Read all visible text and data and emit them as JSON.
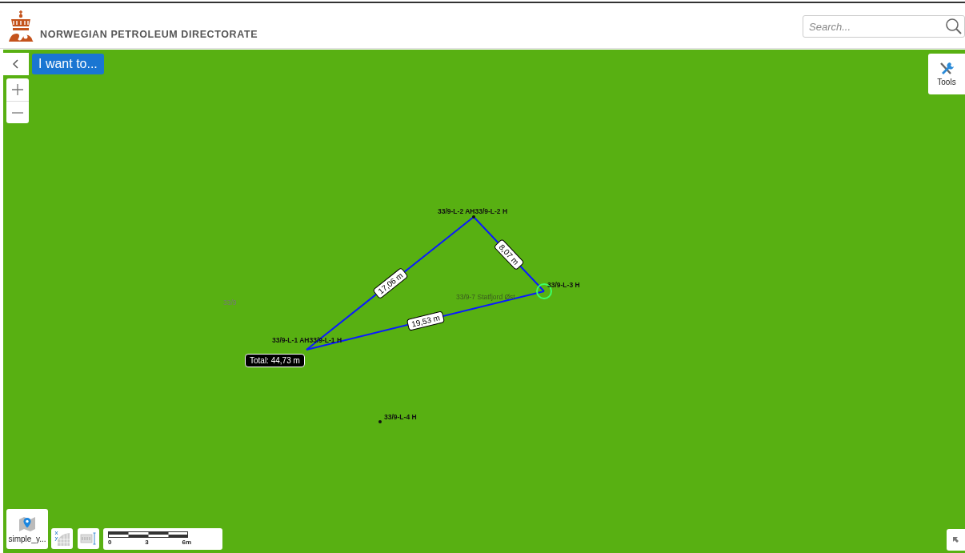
{
  "header": {
    "title": "NORWEGIAN PETROLEUM DIRECTORATE",
    "search": {
      "placeholder": "Search..."
    }
  },
  "controls": {
    "menu_button": "I want to...",
    "tools": "Tools"
  },
  "map": {
    "labels": [
      {
        "kind": "well",
        "text": "33/9-L-2 AH33/9-L-2 H"
      },
      {
        "kind": "well",
        "text": "33/9-L-3 H"
      },
      {
        "kind": "block",
        "text": "33/9"
      },
      {
        "kind": "field",
        "text": "33/9-7 Statfjord Øst"
      },
      {
        "kind": "well",
        "text": "33/9-L-1 AH33/9-L-1 H"
      },
      {
        "kind": "well",
        "text": "33/9-L-4 H"
      }
    ],
    "measurement": {
      "segments": [
        "17,06 m",
        "8,07 m",
        "19,53 m"
      ],
      "total": "Total: 44,73 m"
    }
  },
  "basemap": {
    "label": "simple_y..."
  },
  "scale": {
    "ticks": [
      "0",
      "3",
      "6m"
    ]
  }
}
